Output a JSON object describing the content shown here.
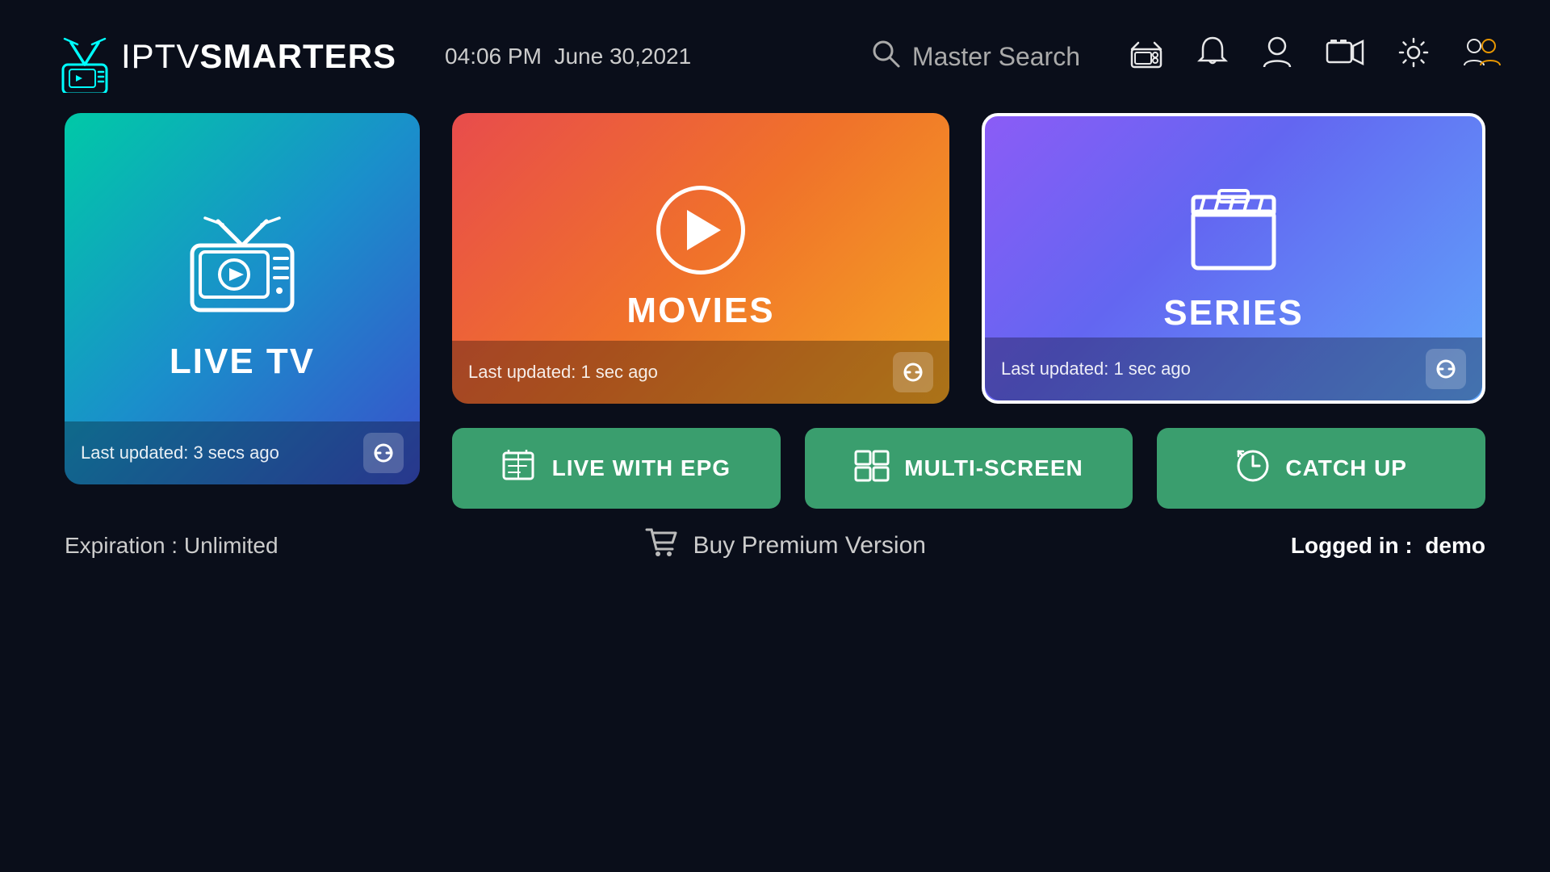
{
  "header": {
    "logo_iptv": "IPTV",
    "logo_smarters": "SMARTERS",
    "time": "04:06 PM",
    "date": "June 30,2021",
    "search_placeholder": "Master Search",
    "icons": {
      "radio": "radio-icon",
      "bell": "bell-icon",
      "user": "user-icon",
      "rec": "rec-icon",
      "settings": "settings-icon",
      "switch_user": "switch-user-icon"
    }
  },
  "cards": {
    "live_tv": {
      "title": "LIVE TV",
      "update_text": "Last updated: 3 secs ago"
    },
    "movies": {
      "title": "MOVIES",
      "update_text": "Last updated: 1 sec ago"
    },
    "series": {
      "title": "SERIES",
      "update_text": "Last updated: 1 sec ago"
    }
  },
  "buttons": {
    "live_with_epg": "LIVE WITH EPG",
    "multi_screen": "MULTI-SCREEN",
    "catch_up": "CATCH UP"
  },
  "footer": {
    "expiration_label": "Expiration :",
    "expiration_value": "Unlimited",
    "buy_premium": "Buy Premium Version",
    "logged_in_label": "Logged in :",
    "logged_in_user": "demo"
  }
}
